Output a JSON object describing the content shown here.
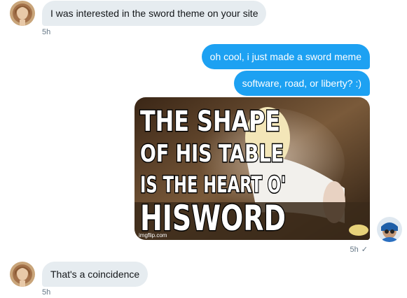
{
  "conversation": {
    "messages": [
      {
        "id": "m1",
        "direction": "incoming",
        "text": "I was interested in the sword theme on your site"
      },
      {
        "id": "m2",
        "direction": "outgoing",
        "text": "oh cool, i just made a sword meme"
      },
      {
        "id": "m3",
        "direction": "outgoing",
        "text": "software, road, or liberty? :)"
      },
      {
        "id": "m4",
        "direction": "outgoing",
        "type": "image",
        "image": {
          "caption_lines": [
            "THE SHAPE",
            "OF HIS TABLE",
            "IS THE HEART O'",
            "HISWORD"
          ],
          "watermark": "imgflip.com"
        }
      },
      {
        "id": "m5",
        "direction": "incoming",
        "text": "That's a coincidence"
      }
    ],
    "timestamps": {
      "t1": "5h",
      "t2": "5h",
      "t3": "5h"
    },
    "read_receipt_icon": "checkmark-icon",
    "read_receipt_glyph": "✓"
  },
  "colors": {
    "outgoing_bubble": "#1da1f2",
    "incoming_bubble": "#e6ecf0",
    "timestamp": "#657786"
  }
}
